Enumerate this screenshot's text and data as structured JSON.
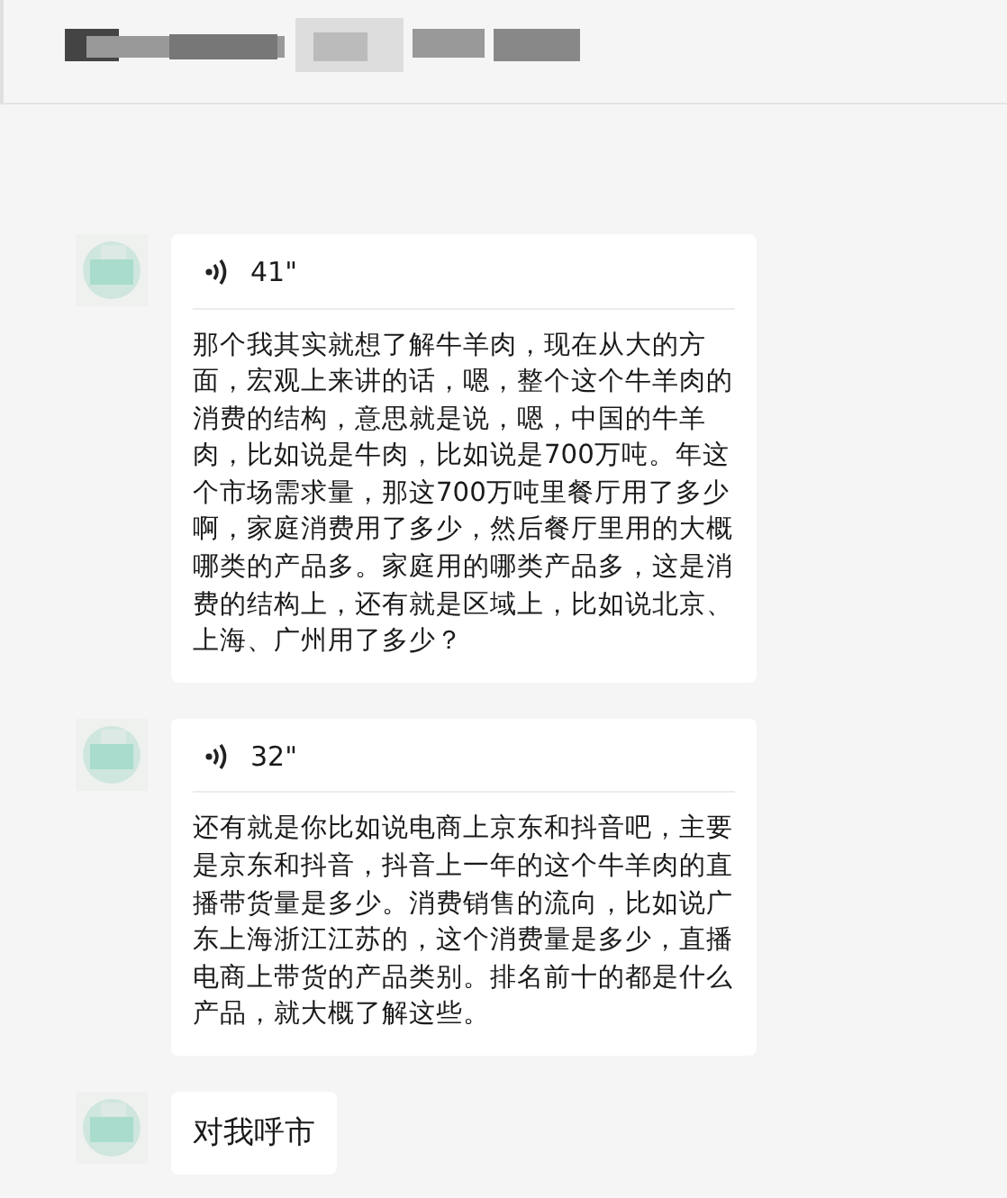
{
  "messages": [
    {
      "kind": "voice",
      "duration": "41\"",
      "transcript": "那个我其实就想了解牛羊肉，现在从大的方面，宏观上来讲的话，嗯，整个这个牛羊肉的消费的结构，意思就是说，嗯，中国的牛羊肉，比如说是牛肉，比如说是700万吨。年这个市场需求量，那这700万吨里餐厅用了多少啊，家庭消费用了多少，然后餐厅里用的大概哪类的产品多。家庭用的哪类产品多，这是消费的结构上，还有就是区域上，比如说北京、上海、广州用了多少？"
    },
    {
      "kind": "voice",
      "duration": "32\"",
      "transcript": "还有就是你比如说电商上京东和抖音吧，主要是京东和抖音，抖音上一年的这个牛羊肉的直播带货量是多少。消费销售的流向，比如说广东上海浙江江苏的，这个消费量是多少，直播电商上带货的产品类别。排名前十的都是什么产品，就大概了解这些。"
    },
    {
      "kind": "text",
      "text": "对我呼市"
    }
  ]
}
